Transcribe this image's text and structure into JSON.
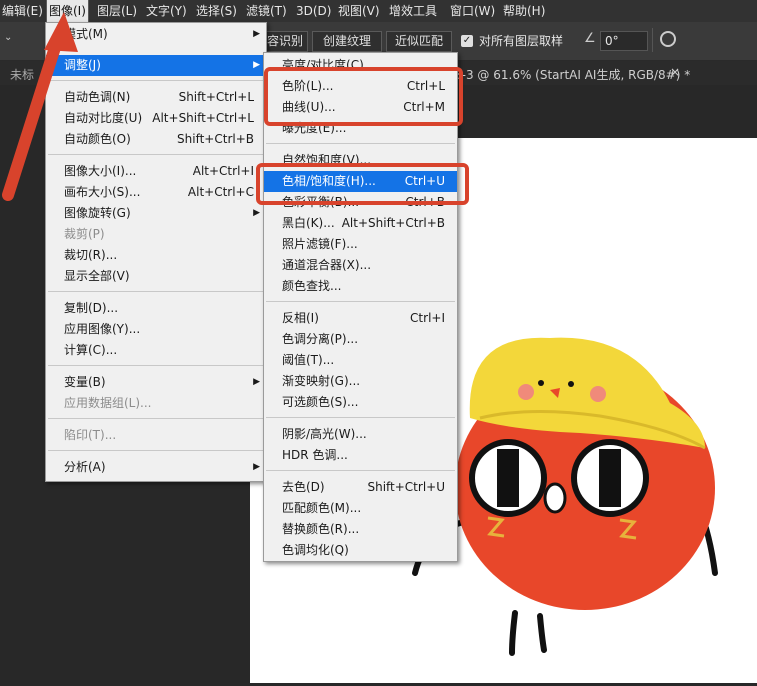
{
  "menubar": {
    "items": [
      "编辑(E)",
      "图像(I)",
      "图层(L)",
      "文字(Y)",
      "选择(S)",
      "滤镜(T)",
      "3D(D)",
      "视图(V)",
      "增效工具",
      "窗口(W)",
      "帮助(H)"
    ]
  },
  "optionsbar": {
    "btn_recognize": "容识别",
    "btn_texture": "创建纹理",
    "btn_approx": "近似匹配",
    "checkbox_label": "对所有图层取样",
    "angle_value": "0°"
  },
  "tabbar": {
    "left_tab": "未标",
    "doc_title": "3-3 @ 61.6% (StartAI AI生成, RGB/8#) *",
    "close": "×"
  },
  "image_menu": {
    "mode": "模式(M)",
    "adjust": "调整(J)",
    "auto_tone": "自动色调(N)",
    "auto_tone_sc": "Shift+Ctrl+L",
    "auto_contrast": "自动对比度(U)",
    "auto_contrast_sc": "Alt+Shift+Ctrl+L",
    "auto_color": "自动颜色(O)",
    "auto_color_sc": "Shift+Ctrl+B",
    "image_size": "图像大小(I)...",
    "image_size_sc": "Alt+Ctrl+I",
    "canvas_size": "画布大小(S)...",
    "canvas_size_sc": "Alt+Ctrl+C",
    "rotate": "图像旋转(G)",
    "crop": "裁剪(P)",
    "trim": "裁切(R)...",
    "reveal_all": "显示全部(V)",
    "duplicate": "复制(D)...",
    "apply_image": "应用图像(Y)...",
    "calculations": "计算(C)...",
    "variables": "变量(B)",
    "apply_dataset": "应用数据组(L)...",
    "trap": "陷印(T)...",
    "analysis": "分析(A)"
  },
  "adjust_menu": {
    "brightness": "亮度/对比度(C)...",
    "levels": "色阶(L)...",
    "levels_sc": "Ctrl+L",
    "curves": "曲线(U)...",
    "curves_sc": "Ctrl+M",
    "exposure": "曝光度(E)...",
    "vibrance": "自然饱和度(V)...",
    "hue_sat": "色相/饱和度(H)...",
    "hue_sat_sc": "Ctrl+U",
    "color_balance": "色彩平衡(B)...",
    "color_balance_sc": "Ctrl+B",
    "bw": "黑白(K)...",
    "bw_sc": "Alt+Shift+Ctrl+B",
    "photo_filter": "照片滤镜(F)...",
    "channel_mixer": "通道混合器(X)...",
    "color_lookup": "颜色查找...",
    "invert": "反相(I)",
    "invert_sc": "Ctrl+I",
    "posterize": "色调分离(P)...",
    "threshold": "阈值(T)...",
    "gradient_map": "渐变映射(G)...",
    "selective_color": "可选颜色(S)...",
    "shadows": "阴影/高光(W)...",
    "hdr": "HDR 色调...",
    "desaturate": "去色(D)",
    "desaturate_sc": "Shift+Ctrl+U",
    "match_color": "匹配颜色(M)...",
    "replace_color": "替换颜色(R)...",
    "equalize": "色调均化(Q)"
  },
  "colors": {
    "accent": "#1473e6",
    "annotation": "#d8432c"
  }
}
